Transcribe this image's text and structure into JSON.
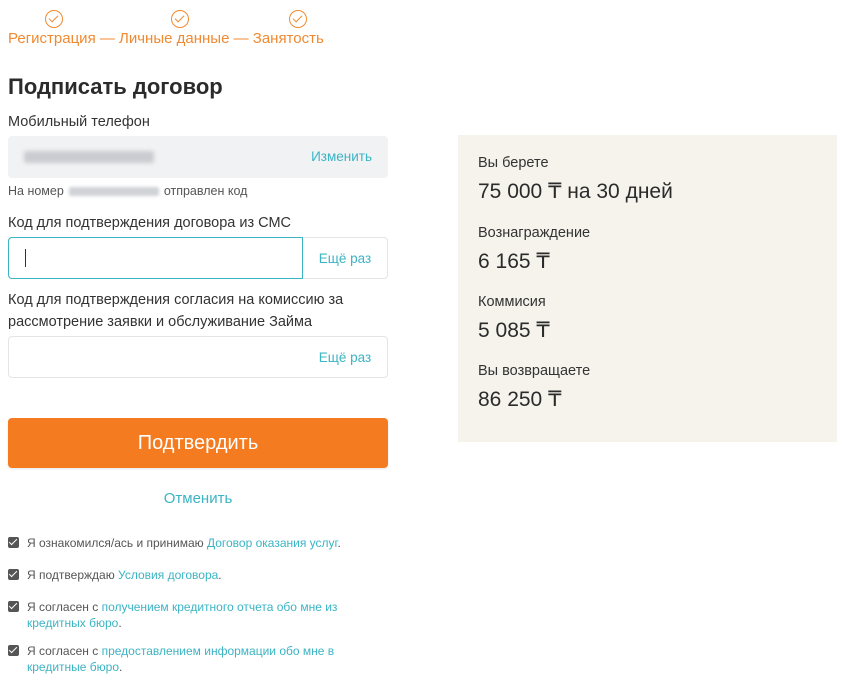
{
  "steps": {
    "label": "Регистрация — Личные данные — Занятость"
  },
  "form": {
    "title": "Подписать договор",
    "phone_label": "Мобильный телефон",
    "change_link": "Изменить",
    "sent_prefix": "На номер",
    "sent_suffix": "отправлен код",
    "sms_code_label": "Код для подтверждения договора из СМС",
    "sms_code_value": "",
    "resend_label": "Ещё раз",
    "commission_code_label_line1": "Код для подтверждения согласия на комиссию за",
    "commission_code_label_line2": "рассмотрение заявки и обслуживание Займа",
    "commission_code_value": "",
    "confirm_button": "Подтвердить",
    "cancel_link": "Отменить"
  },
  "agreements": [
    {
      "text": "Я ознакомился/ась и принимаю ",
      "link": "Договор оказания услуг",
      "after": ".",
      "checked": true
    },
    {
      "text": "Я подтверждаю ",
      "link": "Условия договора",
      "after": ".",
      "checked": true
    },
    {
      "text": "Я согласен с ",
      "link": "получением кредитного отчета обо мне из кредитных бюро",
      "after": ".",
      "checked": true
    },
    {
      "text": "Я согласен с ",
      "link": "предоставлением информации обо мне в кредитные бюро",
      "after": ".",
      "checked": true
    }
  ],
  "summary": {
    "take_label": "Вы берете",
    "take_value": "75 000 ₸ на 30 дней",
    "reward_label": "Вознаграждение",
    "reward_value": "6 165 ₸",
    "commission_label": "Коммисия",
    "commission_value": "5 085 ₸",
    "return_label": "Вы возвращаете",
    "return_value": "86 250 ₸"
  },
  "colors": {
    "accent_orange": "#f47b20",
    "link_teal": "#3bb4c4",
    "summary_bg": "#f6f3ec"
  }
}
